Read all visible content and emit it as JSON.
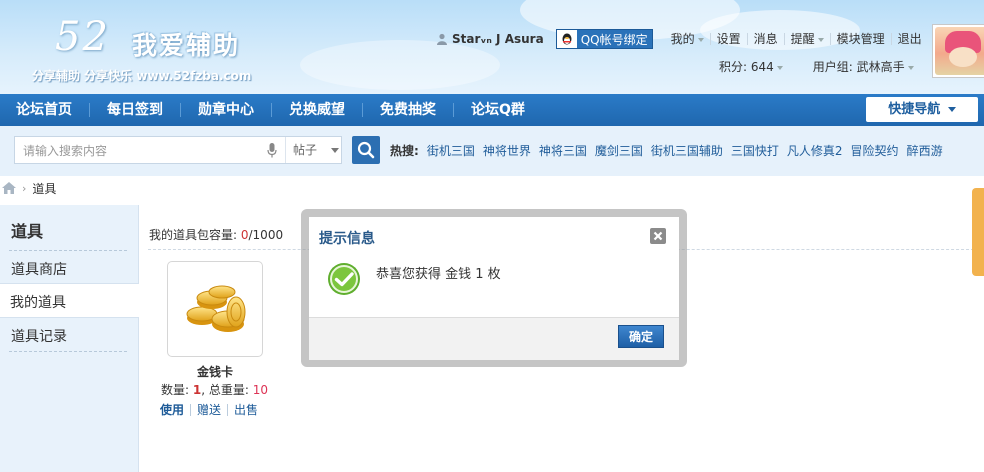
{
  "header": {
    "logo_number": "52",
    "logo_title": "我爱辅助",
    "logo_slogan": "分享辅助 分享快乐 www.52fzba.com",
    "username": "Starᵥₙ J Asura",
    "qq_bind_label": "QQ帐号绑定",
    "links": [
      "我的",
      "设置",
      "消息",
      "提醒",
      "模块管理",
      "退出"
    ],
    "points": "积分: 644",
    "user_group": "用户组: 武林高手"
  },
  "nav": {
    "items": [
      "论坛首页",
      "每日签到",
      "勋章中心",
      "兑换威望",
      "免费抽奖",
      "论坛Q群"
    ],
    "quick_nav": "快捷导航"
  },
  "search": {
    "placeholder": "请输入搜索内容",
    "type_selected": "帖子",
    "hot_label": "热搜:",
    "hot_keywords": [
      "街机三国",
      "神将世界",
      "神将三国",
      "魔剑三国",
      "街机三国辅助",
      "三国快打",
      "凡人修真2",
      "冒险契约",
      "醉西游"
    ]
  },
  "breadcrumb": {
    "current": "道具"
  },
  "sidebar": {
    "title": "道具",
    "items": [
      "道具商店",
      "我的道具",
      "道具记录"
    ],
    "active_index": 1
  },
  "main": {
    "capacity_label": "我的道具包容量: ",
    "capacity_used": "0",
    "capacity_total": "/1000",
    "item": {
      "name": "金钱卡",
      "qty_label": "数量: ",
      "qty": "1",
      "weight_label": ", 总重量: ",
      "weight": "10",
      "actions": [
        "使用",
        "赠送",
        "出售"
      ]
    }
  },
  "dialog": {
    "title": "提示信息",
    "message": "恭喜您获得 金钱 1 枚",
    "ok_label": "确定"
  },
  "colors": {
    "nav_blue": "#2b7bc8",
    "link_blue": "#1f5c99",
    "accent_red": "#cc3333",
    "right_tab": "#f2b24e"
  }
}
